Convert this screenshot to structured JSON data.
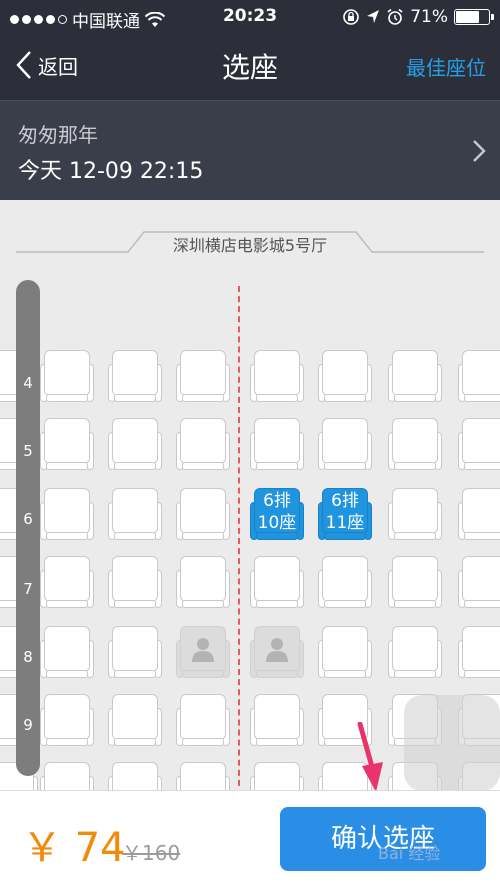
{
  "status_bar": {
    "carrier": "中国联通",
    "time": "20:23",
    "battery": "71%",
    "battery_level": 0.71
  },
  "nav": {
    "back_label": "返回",
    "title": "选座",
    "best_seat_label": "最佳座位"
  },
  "movie": {
    "name": "匆匆那年",
    "showtime": "今天 12-09 22:15"
  },
  "hall": {
    "name": "深圳横店电影城5号厅"
  },
  "rows": [
    "4",
    "5",
    "6",
    "7",
    "8",
    "9"
  ],
  "selected_seats": [
    {
      "row_label": "6排",
      "seat_label": "10座"
    },
    {
      "row_label": "6排",
      "seat_label": "11座"
    }
  ],
  "bottom": {
    "price": "￥ 74",
    "original_price": "￥160",
    "confirm_label": "确认选座"
  },
  "colors": {
    "accent": "#24a0e6",
    "selected_seat": "#1f95e0",
    "price": "#f28a0a",
    "center_line": "#e85a5a"
  },
  "watermark": "Bai 经验"
}
